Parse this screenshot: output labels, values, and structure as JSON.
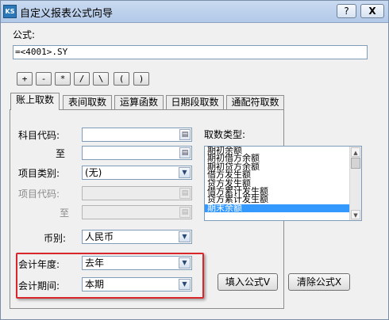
{
  "window": {
    "title": "自定义报表公式向导",
    "app_icon_text": "KS",
    "help_label": "?",
    "close_label": "X"
  },
  "formula": {
    "label": "公式:",
    "value": "=<4001>.SY"
  },
  "operators": [
    "+",
    "-",
    "*",
    "/",
    "\\",
    "(",
    ")"
  ],
  "tabs": [
    {
      "label": "账上取数",
      "active": true
    },
    {
      "label": "表间取数",
      "active": false
    },
    {
      "label": "运算函数",
      "active": false
    },
    {
      "label": "日期段取数",
      "active": false
    },
    {
      "label": "通配符取数",
      "active": false
    }
  ],
  "form": {
    "account_code_label": "科目代码:",
    "account_code_value": "",
    "to_label": "至",
    "account_code_to_value": "",
    "item_category_label": "项目类别:",
    "item_category_value": "(无)",
    "item_code_label": "项目代码:",
    "item_code_value": "",
    "item_to_label": "至",
    "item_code_to_value": "",
    "currency_label": "币别:",
    "currency_value": "人民币",
    "fiscal_year_label": "会计年度:",
    "fiscal_year_value": "去年",
    "fiscal_period_label": "会计期间:",
    "fiscal_period_value": "本期"
  },
  "fetch_type": {
    "label": "取数类型:",
    "items": [
      "期初余额",
      "期初借方余额",
      "期初贷方余额",
      "借方发生额",
      "贷方发生额",
      "借方累计发生额",
      "贷方累计发生额",
      "期末余额"
    ],
    "selected": "期末余额"
  },
  "buttons": {
    "insert_formula": "填入公式V",
    "clear_formula": "清除公式X"
  },
  "icons": {
    "lookup": "lookup-icon",
    "dropdown": "chevron-down-icon"
  },
  "colors": {
    "highlight": "#d9262a",
    "selection": "#3399ff"
  }
}
